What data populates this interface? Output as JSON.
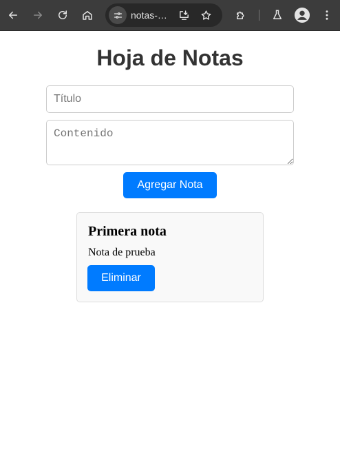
{
  "browser": {
    "url_display": "notas-…",
    "icons": {
      "back": "arrow-left-icon",
      "forward": "arrow-right-icon",
      "reload": "reload-icon",
      "home": "home-icon",
      "site_info": "tune-icon",
      "install": "install-app-icon",
      "bookmark": "star-icon",
      "extensions": "puzzle-icon",
      "labs": "flask-icon",
      "profile": "profile-icon",
      "menu": "kebab-menu-icon"
    },
    "colors": {
      "toolbar": "#3c3c3c",
      "omnibox": "#282828",
      "icon": "#e3e3e3"
    }
  },
  "page": {
    "title": "Hoja de Notas",
    "title_input": {
      "placeholder": "Título",
      "value": ""
    },
    "content_input": {
      "placeholder": "Contenido",
      "value": ""
    },
    "add_button_label": "Agregar Nota",
    "notes": [
      {
        "title": "Primera nota",
        "content": "Nota de prueba",
        "delete_label": "Eliminar"
      }
    ],
    "colors": {
      "accent": "#007bff",
      "heading": "#333333",
      "card_bg": "#f9f9f9",
      "card_border": "#dddddd"
    }
  }
}
